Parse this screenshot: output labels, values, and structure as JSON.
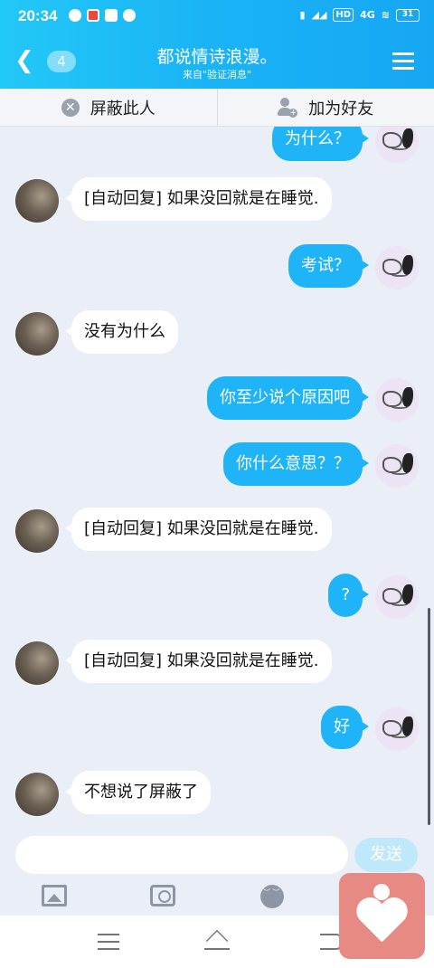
{
  "status_bar": {
    "time": "20:34",
    "network_label": "HD",
    "signal_label": "4G",
    "battery": "31"
  },
  "header": {
    "back_icon": "chevron-left-icon",
    "unread_count": "4",
    "title": "都说情诗浪漫。",
    "subtitle": "来自\"验证消息\"",
    "menu_icon": "hamburger-menu-icon"
  },
  "actions": {
    "block_label": "屏蔽此人",
    "add_friend_label": "加为好友"
  },
  "messages": [
    {
      "direction": "out",
      "text": "为什么？"
    },
    {
      "direction": "in",
      "text": "[自动回复] 如果没回就是在睡觉."
    },
    {
      "direction": "out",
      "text": "考试？"
    },
    {
      "direction": "in",
      "text": "没有为什么"
    },
    {
      "direction": "out",
      "text": "你至少说个原因吧"
    },
    {
      "direction": "out",
      "text": "你什么意思？？"
    },
    {
      "direction": "in",
      "text": "[自动回复] 如果没回就是在睡觉."
    },
    {
      "direction": "out",
      "text": "?"
    },
    {
      "direction": "in",
      "text": "[自动回复] 如果没回就是在睡觉."
    },
    {
      "direction": "out",
      "text": "好"
    },
    {
      "direction": "in",
      "text": "不想说了屏蔽了"
    }
  ],
  "composer": {
    "input_value": "",
    "send_label": "发送"
  },
  "toolbar": [
    "image-icon",
    "camera-icon",
    "emoji-icon"
  ],
  "nav_bar": [
    "menu-icon",
    "home-icon",
    "back-icon"
  ],
  "colors": {
    "header_blue": "#1ab3f6",
    "outgoing_bubble": "#1eb4f7",
    "incoming_bubble": "#ffffff",
    "chat_background": "#eaeef6",
    "send_button_disabled": "#bfe9fb"
  }
}
